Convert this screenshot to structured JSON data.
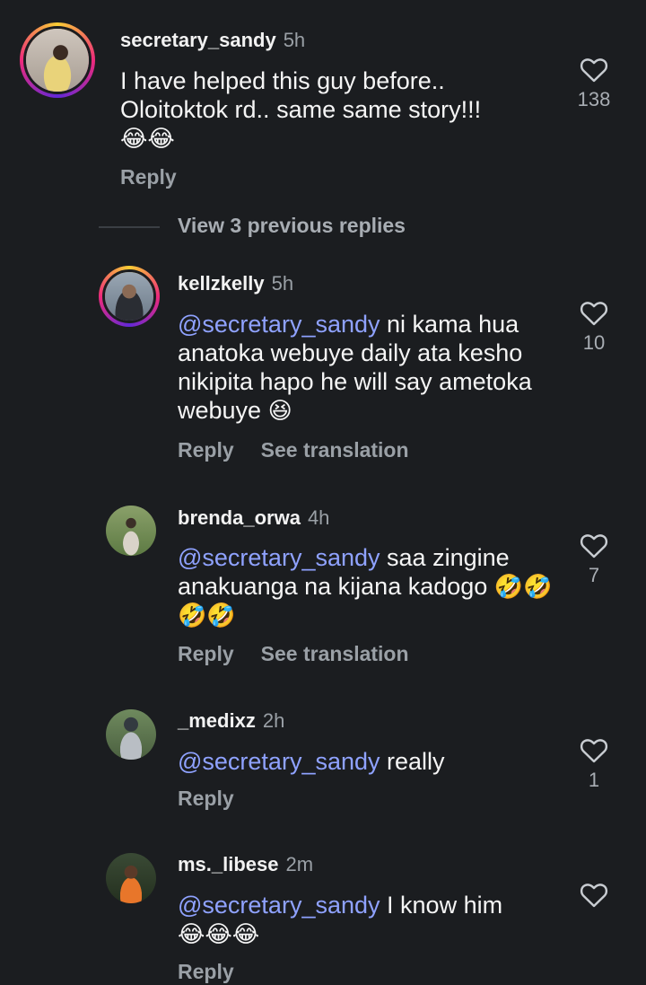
{
  "comments": [
    {
      "username": "secretary_sandy",
      "time": "5h",
      "text": "I have helped this guy before.. Oloitoktok rd.. same same story!!!",
      "emoji": "😂😂",
      "reply_label": "Reply",
      "likes": "138"
    },
    {
      "username": "kellzkelly",
      "time": "5h",
      "mention": "@secretary_sandy",
      "text": "ni kama hua anatoka webuye daily ata kesho nikipita hapo he will say ametoka webuye",
      "emoji": "😆",
      "reply_label": "Reply",
      "translate_label": "See translation",
      "likes": "10"
    },
    {
      "username": "brenda_orwa",
      "time": "4h",
      "mention": "@secretary_sandy",
      "text": "saa zingine anakuanga na kijana kadogo",
      "emoji": "🤣🤣🤣🤣",
      "reply_label": "Reply",
      "translate_label": "See translation",
      "likes": "7"
    },
    {
      "username": "_medixz",
      "time": "2h",
      "mention": "@secretary_sandy",
      "text": "really",
      "reply_label": "Reply",
      "likes": "1"
    },
    {
      "username": "ms._libese",
      "time": "2m",
      "mention": "@secretary_sandy",
      "text": "I know him",
      "emoji": "😂😂😂",
      "reply_label": "Reply"
    }
  ],
  "view_previous_replies": "View 3 previous replies",
  "colors": {
    "background": "#1b1d20",
    "mention": "#8fa2ff",
    "secondary_text": "#9aa0a6"
  }
}
